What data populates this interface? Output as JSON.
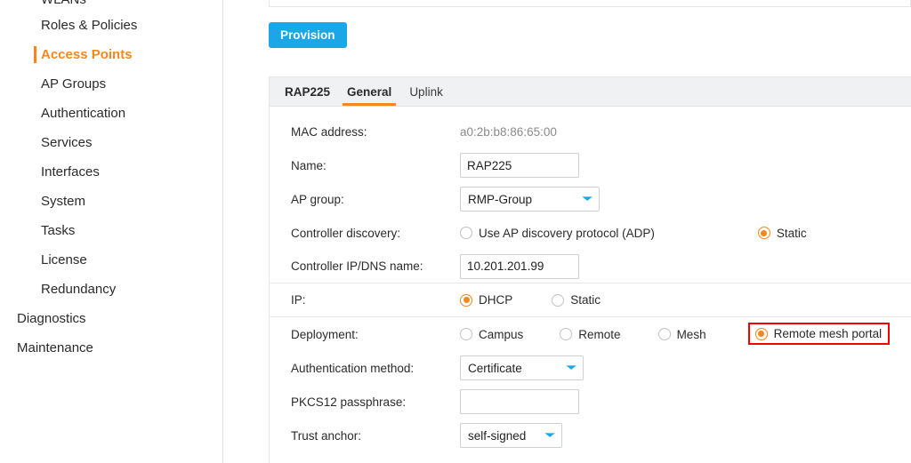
{
  "sidebar": {
    "items": [
      {
        "label": "WLANs",
        "level": 2,
        "active": false,
        "clipped": true
      },
      {
        "label": "Roles & Policies",
        "level": 2,
        "active": false,
        "clipped": false
      },
      {
        "label": "Access Points",
        "level": 2,
        "active": true,
        "clipped": false
      },
      {
        "label": "AP Groups",
        "level": 2,
        "active": false,
        "clipped": false
      },
      {
        "label": "Authentication",
        "level": 2,
        "active": false,
        "clipped": false
      },
      {
        "label": "Services",
        "level": 2,
        "active": false,
        "clipped": false
      },
      {
        "label": "Interfaces",
        "level": 2,
        "active": false,
        "clipped": false
      },
      {
        "label": "System",
        "level": 2,
        "active": false,
        "clipped": false
      },
      {
        "label": "Tasks",
        "level": 2,
        "active": false,
        "clipped": false
      },
      {
        "label": "License",
        "level": 2,
        "active": false,
        "clipped": false
      },
      {
        "label": "Redundancy",
        "level": 2,
        "active": false,
        "clipped": false
      },
      {
        "label": "Diagnostics",
        "level": 1,
        "active": false,
        "clipped": false
      },
      {
        "label": "Maintenance",
        "level": 1,
        "active": false,
        "clipped": false
      }
    ]
  },
  "toolbar": {
    "provision_label": "Provision"
  },
  "tabs": [
    {
      "label": "RAP225",
      "type": "title",
      "active": false
    },
    {
      "label": "General",
      "type": "tab",
      "active": true
    },
    {
      "label": "Uplink",
      "type": "tab",
      "active": false
    }
  ],
  "form": {
    "mac_address": {
      "label": "MAC address:",
      "value": "a0:2b:b8:86:65:00"
    },
    "name": {
      "label": "Name:",
      "value": "RAP225",
      "placeholder": ""
    },
    "ap_group": {
      "label": "AP group:",
      "value": "RMP-Group"
    },
    "controller_discovery": {
      "label": "Controller discovery:",
      "options": [
        {
          "label": "Use AP discovery protocol (ADP)",
          "selected": false
        },
        {
          "label": "Static",
          "selected": true
        }
      ]
    },
    "controller_ip": {
      "label": "Controller IP/DNS name:",
      "value": "10.201.201.99",
      "placeholder": ""
    },
    "ip": {
      "label": "IP:",
      "options": [
        {
          "label": "DHCP",
          "selected": true
        },
        {
          "label": "Static",
          "selected": false
        }
      ]
    },
    "deployment": {
      "label": "Deployment:",
      "options": [
        {
          "label": "Campus",
          "selected": false,
          "highlighted": false
        },
        {
          "label": "Remote",
          "selected": false,
          "highlighted": false
        },
        {
          "label": "Mesh",
          "selected": false,
          "highlighted": false
        },
        {
          "label": "Remote mesh portal",
          "selected": true,
          "highlighted": true
        }
      ]
    },
    "auth_method": {
      "label": "Authentication method:",
      "value": "Certificate"
    },
    "pkcs12": {
      "label": "PKCS12 passphrase:",
      "value": "",
      "placeholder": ""
    },
    "trust_anchor": {
      "label": "Trust anchor:",
      "value": "self-signed"
    }
  },
  "colors": {
    "accent_orange": "#f5871f",
    "button_blue": "#19a7e8",
    "highlight_red": "#f40000",
    "chevron_blue": "#19a7e8"
  }
}
